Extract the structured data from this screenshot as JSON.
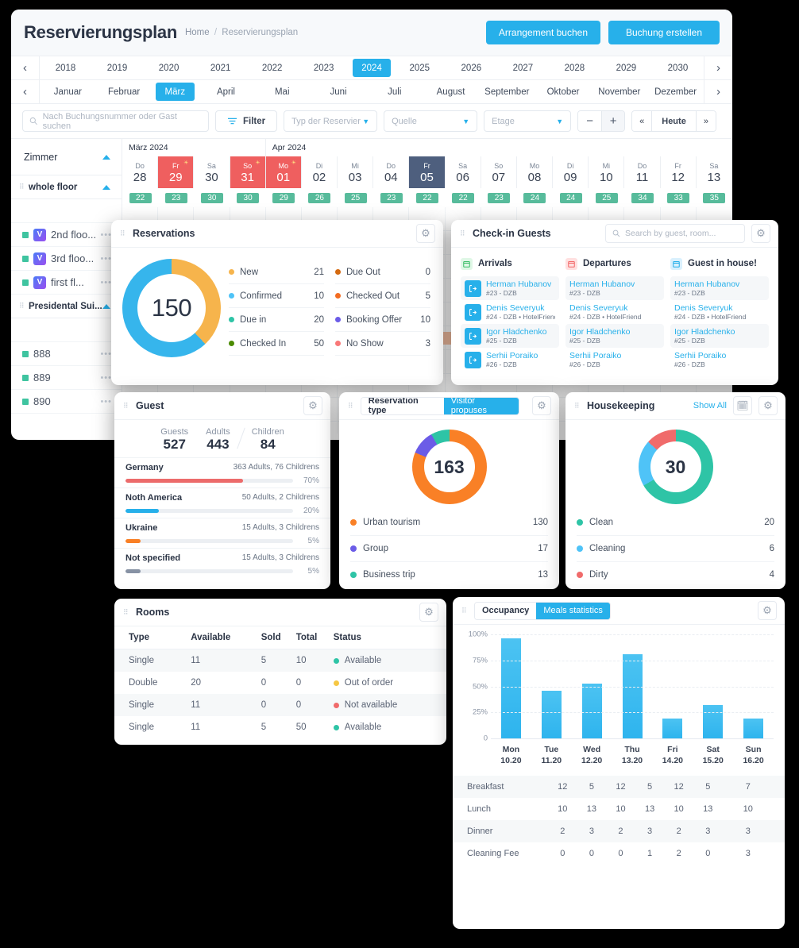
{
  "header": {
    "title": "Reservierungsplan",
    "breadcrumb_home": "Home",
    "breadcrumb_sep": "/",
    "breadcrumb_current": "Reservierungsplan",
    "btn_arrangement": "Arrangement buchen",
    "btn_booking": "Buchung erstellen",
    "accent": "#27b0ea"
  },
  "years": {
    "items": [
      "2018",
      "2019",
      "2020",
      "2021",
      "2022",
      "2023",
      "2024",
      "2025",
      "2026",
      "2027",
      "2028",
      "2029",
      "2030"
    ],
    "selected": "2024"
  },
  "months": {
    "items": [
      "Januar",
      "Februar",
      "März",
      "April",
      "Mai",
      "Juni",
      "Juli",
      "August",
      "September",
      "Oktober",
      "November",
      "Dezember"
    ],
    "selected": "März"
  },
  "filters": {
    "search_placeholder": "Nach Buchungsnummer oder Gast suchen",
    "filter_label": "Filter",
    "type_placeholder": "Typ der Reservier",
    "source_placeholder": "Quelle",
    "floor_placeholder": "Etage",
    "zoom_out": "−",
    "zoom_in": "+",
    "prev": "«",
    "today": "Heute",
    "next": "»"
  },
  "calendar": {
    "rooms_label": "Zimmer",
    "months_spans": [
      {
        "label": "März 2024",
        "days": 4
      },
      {
        "label": "Apr 2024",
        "days": 13
      }
    ],
    "days": [
      {
        "dw": "Do",
        "dn": "28",
        "occ": "22",
        "state": "normal"
      },
      {
        "dw": "Fr",
        "dn": "29",
        "occ": "23",
        "state": "weekend",
        "sun": true
      },
      {
        "dw": "Sa",
        "dn": "30",
        "occ": "30",
        "state": "normal"
      },
      {
        "dw": "So",
        "dn": "31",
        "occ": "30",
        "state": "weekend",
        "sun": true
      },
      {
        "dw": "Mo",
        "dn": "01",
        "occ": "29",
        "state": "weekend",
        "sun": true
      },
      {
        "dw": "Di",
        "dn": "02",
        "occ": "26",
        "state": "normal"
      },
      {
        "dw": "Mi",
        "dn": "03",
        "occ": "25",
        "state": "normal"
      },
      {
        "dw": "Do",
        "dn": "04",
        "occ": "23",
        "state": "normal"
      },
      {
        "dw": "Fr",
        "dn": "05",
        "occ": "22",
        "state": "today"
      },
      {
        "dw": "Sa",
        "dn": "06",
        "occ": "22",
        "state": "normal"
      },
      {
        "dw": "So",
        "dn": "07",
        "occ": "23",
        "state": "normal"
      },
      {
        "dw": "Mo",
        "dn": "08",
        "occ": "24",
        "state": "normal"
      },
      {
        "dw": "Di",
        "dn": "09",
        "occ": "24",
        "state": "normal"
      },
      {
        "dw": "Mi",
        "dn": "10",
        "occ": "25",
        "state": "normal"
      },
      {
        "dw": "Do",
        "dn": "11",
        "occ": "34",
        "state": "normal"
      },
      {
        "dw": "Fr",
        "dn": "12",
        "occ": "33",
        "state": "normal"
      },
      {
        "dw": "Sa",
        "dn": "13",
        "occ": "35",
        "state": "normal"
      }
    ],
    "rows": [
      {
        "kind": "group",
        "label": "whole floor"
      },
      {
        "kind": "blank"
      },
      {
        "kind": "room",
        "label": "2nd floo...",
        "badge": "V"
      },
      {
        "kind": "room",
        "label": "3rd floo...",
        "badge": "V"
      },
      {
        "kind": "room",
        "label": "first fl...",
        "badge": "V"
      },
      {
        "kind": "group",
        "label": "Presidental Sui..."
      },
      {
        "kind": "blank"
      },
      {
        "kind": "room",
        "label": "888"
      },
      {
        "kind": "room",
        "label": "889"
      },
      {
        "kind": "room",
        "label": "890"
      }
    ]
  },
  "reservations": {
    "title": "Reservations",
    "total": "150",
    "segments": [
      {
        "color": "#f6b44c",
        "pct": 38
      },
      {
        "color": "#36b5ec",
        "pct": 62
      }
    ],
    "left": [
      {
        "label": "New",
        "value": "21",
        "color": "#f6b44c"
      },
      {
        "label": "Confirmed",
        "value": "10",
        "color": "#4fc3f7"
      },
      {
        "label": "Due in",
        "value": "20",
        "color": "#2ec4a6"
      },
      {
        "label": "Checked In",
        "value": "50",
        "color": "#4b8b00"
      }
    ],
    "right": [
      {
        "label": "Due Out",
        "value": "0",
        "color": "#d4690f"
      },
      {
        "label": "Checked Out",
        "value": "5",
        "color": "#f36c21"
      },
      {
        "label": "Booking Offer",
        "value": "10",
        "color": "#6b5ce7"
      },
      {
        "label": "No Show",
        "value": "3",
        "color": "#f97878"
      }
    ]
  },
  "checkin": {
    "title": "Check-in Guests",
    "search_placeholder": "Search by guest, room...",
    "columns": [
      {
        "title": "Arrivals",
        "icon": "calendar-arrival-icon",
        "icon_bg": "#dff7e6",
        "icon_fg": "#3fbf6a",
        "show_avatar": true,
        "items": [
          {
            "name": "Herman Hubanov",
            "sub": "#23 - DZB"
          },
          {
            "name": "Denis Severyuk",
            "sub": "#24 - DZB • HotelFriend"
          },
          {
            "name": "Igor Hladchenko",
            "sub": "#25 - DZB"
          },
          {
            "name": "Serhii Poraiko",
            "sub": "#26 - DZB"
          }
        ]
      },
      {
        "title": "Departures",
        "icon": "calendar-departure-icon",
        "icon_bg": "#ffe0e0",
        "icon_fg": "#f26b6b",
        "show_avatar": false,
        "items": [
          {
            "name": "Herman Hubanov",
            "sub": "#23 - DZB"
          },
          {
            "name": "Denis Severyuk",
            "sub": "#24 - DZB • HotelFriend"
          },
          {
            "name": "Igor Hladchenko",
            "sub": "#25 - DZB"
          },
          {
            "name": "Serhii Poraiko",
            "sub": "#26 - DZB"
          }
        ]
      },
      {
        "title": "Guest in house!",
        "icon": "house-icon",
        "icon_bg": "#d9f0fd",
        "icon_fg": "#27b0ea",
        "show_avatar": false,
        "items": [
          {
            "name": "Herman Hubanov",
            "sub": "#23 - DZB"
          },
          {
            "name": "Denis Severyuk",
            "sub": "#24 - DZB • HotelFriend"
          },
          {
            "name": "Igor Hladchenko",
            "sub": "#25 - DZB"
          },
          {
            "name": "Serhii Poraiko",
            "sub": "#26 - DZB"
          }
        ]
      }
    ]
  },
  "guest": {
    "title": "Guest",
    "stats": [
      {
        "key": "Guests",
        "value": "527"
      },
      {
        "key": "Adults",
        "value": "443"
      },
      {
        "key": "Children",
        "value": "84"
      }
    ],
    "rows": [
      {
        "name": "Germany",
        "counts": "363 Adults, 76 Childrens",
        "pct": "70%",
        "width": 70,
        "color": "#ec6b6b"
      },
      {
        "name": "Noth America",
        "counts": "50 Adults, 2 Childrens",
        "pct": "20%",
        "width": 20,
        "color": "#27b0ea"
      },
      {
        "name": "Ukraine",
        "counts": "15 Adults, 3 Childrens",
        "pct": "5%",
        "width": 9,
        "color": "#f98026"
      },
      {
        "name": "Not specified",
        "counts": "15 Adults, 3 Childrens",
        "pct": "5%",
        "width": 9,
        "color": "#8792a4"
      }
    ]
  },
  "restype": {
    "tab_left": "Reservation type",
    "tab_right": "Visitor propuses",
    "total": "163",
    "rows": [
      {
        "label": "Urban tourism",
        "value": "130",
        "color": "#f98026"
      },
      {
        "label": "Group",
        "value": "17",
        "color": "#6b5ce7"
      },
      {
        "label": "Business trip",
        "value": "13",
        "color": "#2ec4a6"
      }
    ],
    "chart_data": {
      "type": "pie",
      "title": "Reservation type",
      "categories": [
        "Urban tourism",
        "Group",
        "Business trip"
      ],
      "values": [
        130,
        17,
        13
      ],
      "colors": [
        "#f98026",
        "#6b5ce7",
        "#2ec4a6"
      ],
      "total": 163,
      "legend": "bottom"
    }
  },
  "housekeeping": {
    "title": "Housekeeping",
    "show_all": "Show All",
    "total": "30",
    "rows": [
      {
        "label": "Clean",
        "value": "20",
        "color": "#2ec4a6"
      },
      {
        "label": "Cleaning",
        "value": "6",
        "color": "#4fc3f7"
      },
      {
        "label": "Dirty",
        "value": "4",
        "color": "#f06b6b"
      }
    ],
    "chart_data": {
      "type": "pie",
      "title": "Housekeeping",
      "categories": [
        "Clean",
        "Cleaning",
        "Dirty"
      ],
      "values": [
        20,
        6,
        4
      ],
      "colors": [
        "#2ec4a6",
        "#4fc3f7",
        "#f06b6b"
      ],
      "total": 30,
      "legend": "bottom"
    }
  },
  "rooms": {
    "title": "Rooms",
    "headers": [
      "Type",
      "Available",
      "Sold",
      "Total",
      "Status"
    ],
    "rows": [
      {
        "type": "Single",
        "available": "11",
        "sold": "5",
        "total": "10",
        "status": "Available",
        "color": "#2ec4a6"
      },
      {
        "type": "Double",
        "available": "20",
        "sold": "0",
        "total": "0",
        "status": "Out of order",
        "color": "#f6c744"
      },
      {
        "type": "Single",
        "available": "11",
        "sold": "0",
        "total": "0",
        "status": "Not available",
        "color": "#f06b6b"
      },
      {
        "type": "Single",
        "available": "11",
        "sold": "5",
        "total": "50",
        "status": "Available",
        "color": "#2ec4a6"
      }
    ]
  },
  "occupancy": {
    "tab_left": "Occupancy",
    "tab_right": "Meals statistics",
    "chart_data": {
      "type": "bar",
      "title": "Meals statistics",
      "categories": [
        "Mon 10.20",
        "Tue 11.20",
        "Wed 12.20",
        "Thu 13.20",
        "Fri 14.20",
        "Sat 15.20",
        "Sun 16.20"
      ],
      "x_top": [
        "Mon",
        "Tue",
        "Wed",
        "Thu",
        "Fri",
        "Sat",
        "Sun"
      ],
      "x_bottom": [
        "10.20",
        "11.20",
        "12.20",
        "13.20",
        "14.20",
        "15.20",
        "16.20"
      ],
      "values": [
        96,
        46,
        53,
        81,
        19,
        32,
        19
      ],
      "ylabel": "",
      "xlabel": "",
      "ylim": [
        0,
        100
      ],
      "yticks": [
        "100%",
        "75%",
        "50%",
        "25%",
        "0"
      ],
      "grid": true,
      "bar_color": "#2eb4ee"
    },
    "meals_rows": [
      {
        "label": "Breakfast",
        "values": [
          "12",
          "5",
          "12",
          "5",
          "12",
          "5",
          "7"
        ]
      },
      {
        "label": "Lunch",
        "values": [
          "10",
          "13",
          "10",
          "13",
          "10",
          "13",
          "10"
        ]
      },
      {
        "label": "Dinner",
        "values": [
          "2",
          "3",
          "2",
          "3",
          "2",
          "3",
          "3"
        ]
      },
      {
        "label": "Cleaning Fee",
        "values": [
          "0",
          "0",
          "0",
          "1",
          "2",
          "0",
          "3"
        ]
      }
    ]
  }
}
